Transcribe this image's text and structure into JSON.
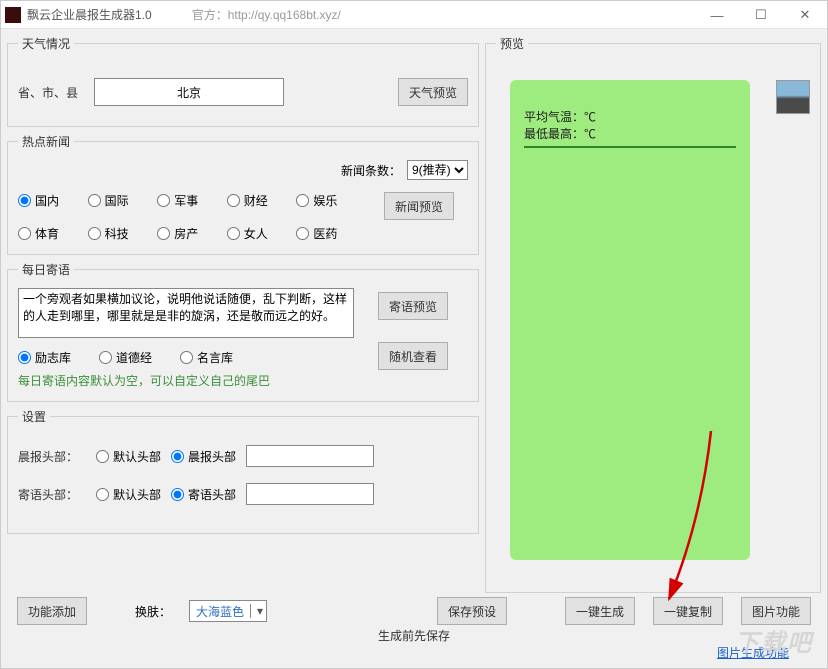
{
  "window": {
    "title": "飘云企业晨报生成器1.0",
    "url_label": "官方：http://qy.qq168bt.xyz/"
  },
  "weather": {
    "legend": "天气情况",
    "label": "省、市、县",
    "value": "北京",
    "preview_btn": "天气预览"
  },
  "news": {
    "legend": "热点新闻",
    "count_label": "新闻条数：",
    "count_value": "9(推荐)",
    "items": [
      "国内",
      "国际",
      "军事",
      "财经",
      "娱乐",
      "体育",
      "科技",
      "房产",
      "女人",
      "医药"
    ],
    "selected": "国内",
    "preview_btn": "新闻预览"
  },
  "quote": {
    "legend": "每日寄语",
    "text": "一个旁观者如果横加议论，说明他说话随便，乱下判断，这样的人走到哪里，哪里就是是非的旋涡，还是敬而远之的好。",
    "source_options": [
      "励志库",
      "道德经",
      "名言库"
    ],
    "source_selected": "励志库",
    "random_btn": "随机查看",
    "preview_btn": "寄语预览",
    "hint": "每日寄语内容默认为空，可以自定义自己的尾巴"
  },
  "settings": {
    "legend": "设置",
    "morning_label": "晨报头部：",
    "default_head": "默认头部",
    "morning_head": "晨报头部",
    "quote_label": "寄语头部：",
    "quote_head": "寄语头部"
  },
  "preview": {
    "legend": "预览",
    "avg_temp_label": "平均气温：",
    "range_label": "最低最高：",
    "degree": "℃"
  },
  "bottom": {
    "add_feature": "功能添加",
    "skin_label": "换肤：",
    "skin_value": "大海蓝色",
    "save_preset": "保存预设",
    "one_gen": "一键生成",
    "one_copy": "一键复制",
    "pic_feature": "图片功能",
    "save_caption": "生成前先保存",
    "pic_link": "图片生成功能"
  },
  "watermark": "下载吧"
}
